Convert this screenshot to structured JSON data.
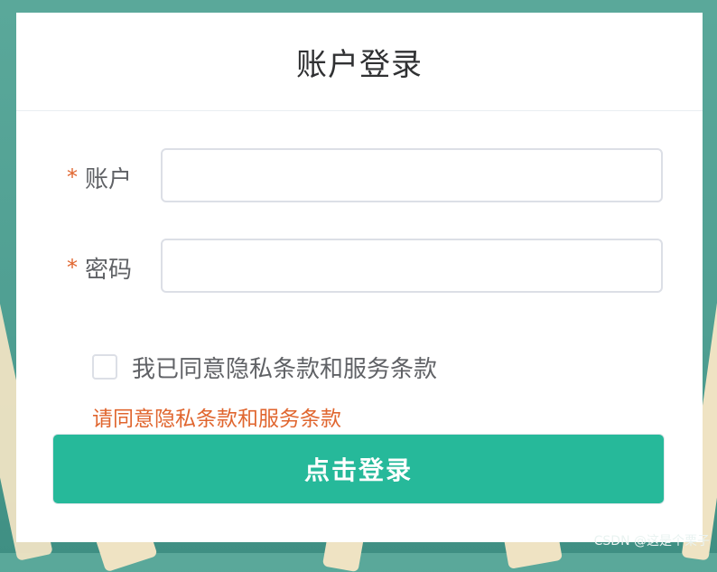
{
  "login": {
    "title": "账户登录",
    "account": {
      "required_mark": "*",
      "label": "账户",
      "value": "",
      "placeholder": ""
    },
    "password": {
      "required_mark": "*",
      "label": "密码",
      "value": "",
      "placeholder": ""
    },
    "agreement": {
      "checked": false,
      "label": "我已同意隐私条款和服务条款"
    },
    "error_message": "请同意隐私条款和服务条款",
    "submit_label": "点击登录"
  },
  "watermark": "CSDN @这是个栗子",
  "colors": {
    "accent": "#26b99a",
    "error": "#e0662f",
    "background": "#4f9f92"
  }
}
